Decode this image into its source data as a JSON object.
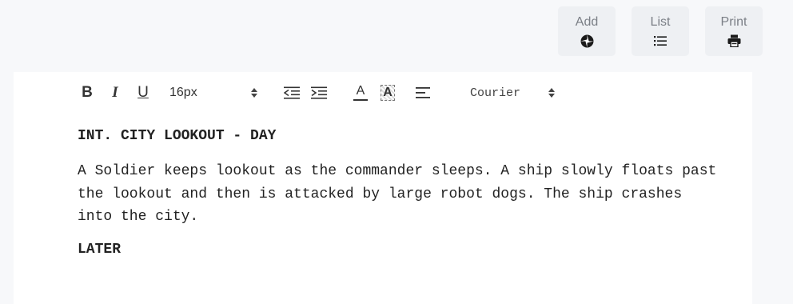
{
  "top_actions": [
    {
      "label": "Add",
      "icon": "add-scene-icon"
    },
    {
      "label": "List",
      "icon": "list-icon"
    },
    {
      "label": "Print",
      "icon": "print-icon"
    }
  ],
  "toolbar": {
    "bold": "B",
    "italic": "I",
    "underline": "U",
    "font_size": "16px",
    "text_color_glyph": "A",
    "highlight_glyph": "A",
    "font_family": "Courier"
  },
  "script": {
    "scene_heading": "INT. CITY LOOKOUT - DAY",
    "action": "A Soldier keeps lookout as the commander sleeps. A ship slowly floats past the lookout and then is attacked by large robot dogs. The ship crashes into the city.",
    "transition": "LATER"
  }
}
